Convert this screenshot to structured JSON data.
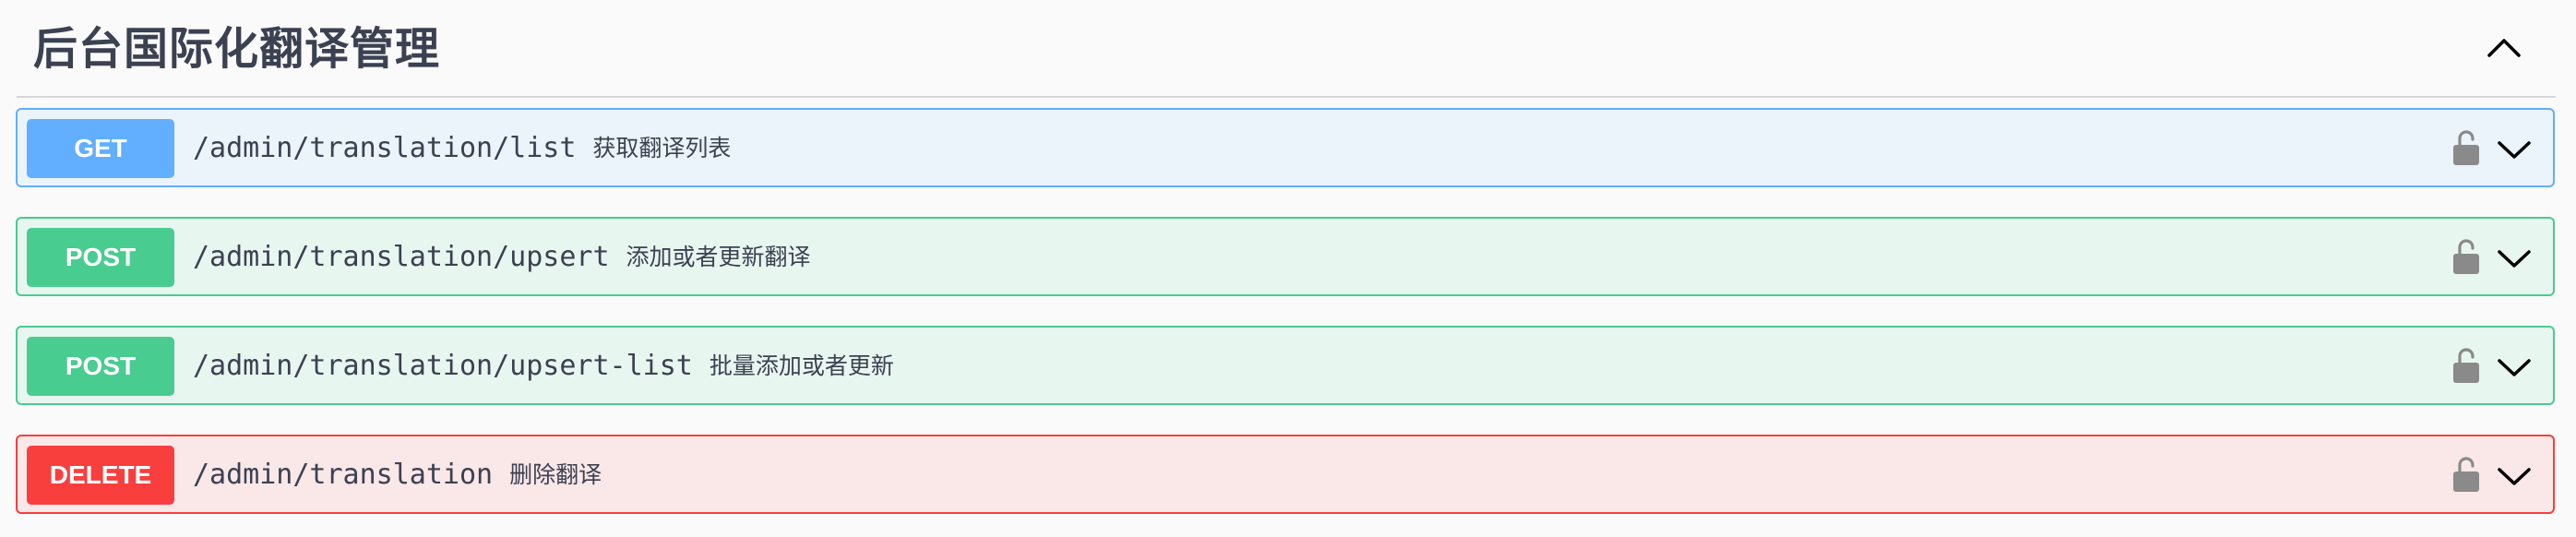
{
  "section": {
    "title": "后台国际化翻译管理",
    "collapse_icon": "chevron-up-icon"
  },
  "operations": [
    {
      "method": "GET",
      "path": "/admin/translation/list",
      "summary": "获取翻译列表",
      "color": "#61affe",
      "bg": "#ebf3fb"
    },
    {
      "method": "POST",
      "path": "/admin/translation/upsert",
      "summary": "添加或者更新翻译",
      "color": "#49cc90",
      "bg": "#e8f6f0"
    },
    {
      "method": "POST",
      "path": "/admin/translation/upsert-list",
      "summary": "批量添加或者更新",
      "color": "#49cc90",
      "bg": "#e8f6f0"
    },
    {
      "method": "DELETE",
      "path": "/admin/translation",
      "summary": "删除翻译",
      "color": "#f93e3e",
      "bg": "#fae7e7"
    }
  ],
  "icons": {
    "lock": "unlocked-icon",
    "expand": "chevron-down-icon"
  }
}
